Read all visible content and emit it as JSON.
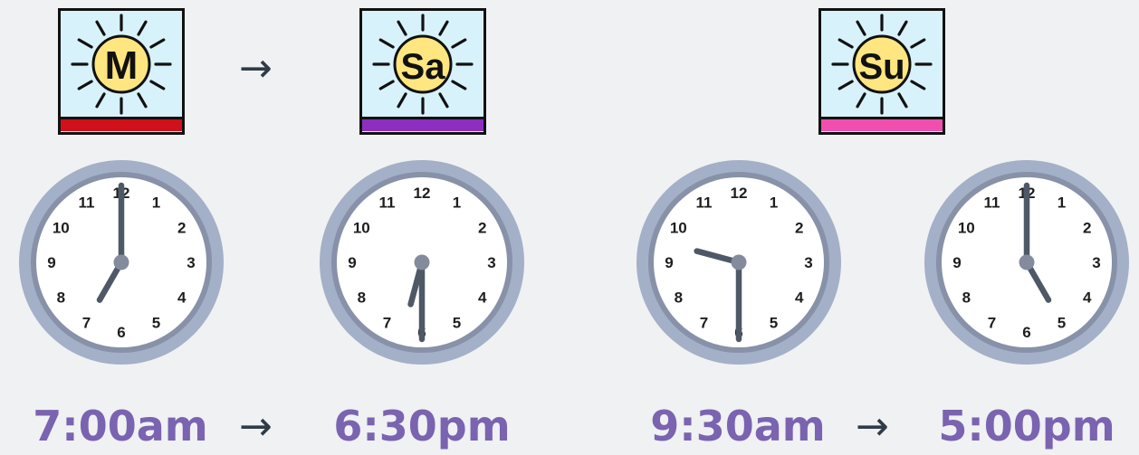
{
  "days": [
    {
      "label": "M",
      "bar_color": "#d0101a"
    },
    {
      "label": "Sa",
      "bar_color": "#8c2fc0"
    },
    {
      "label": "Su",
      "bar_color": "#f04fae"
    }
  ],
  "arrow_symbol": "→",
  "clocks": [
    {
      "hour": 7,
      "minute": 0,
      "time_label": "7:00am"
    },
    {
      "hour": 6,
      "minute": 30,
      "time_label": "6:30pm"
    },
    {
      "hour": 9,
      "minute": 30,
      "time_label": "9:30am"
    },
    {
      "hour": 5,
      "minute": 0,
      "time_label": "5:00pm"
    }
  ],
  "dial_numbers": [
    "12",
    "1",
    "2",
    "3",
    "4",
    "5",
    "6",
    "7",
    "8",
    "9",
    "10",
    "11"
  ],
  "colors": {
    "sun_fill": "#ffe680",
    "icon_bg": "#d8f2fb",
    "clock_rim": "#a3b0c8",
    "clock_ring": "#8791a8",
    "hands": "#4f5866",
    "time_text": "#7a63b0"
  }
}
